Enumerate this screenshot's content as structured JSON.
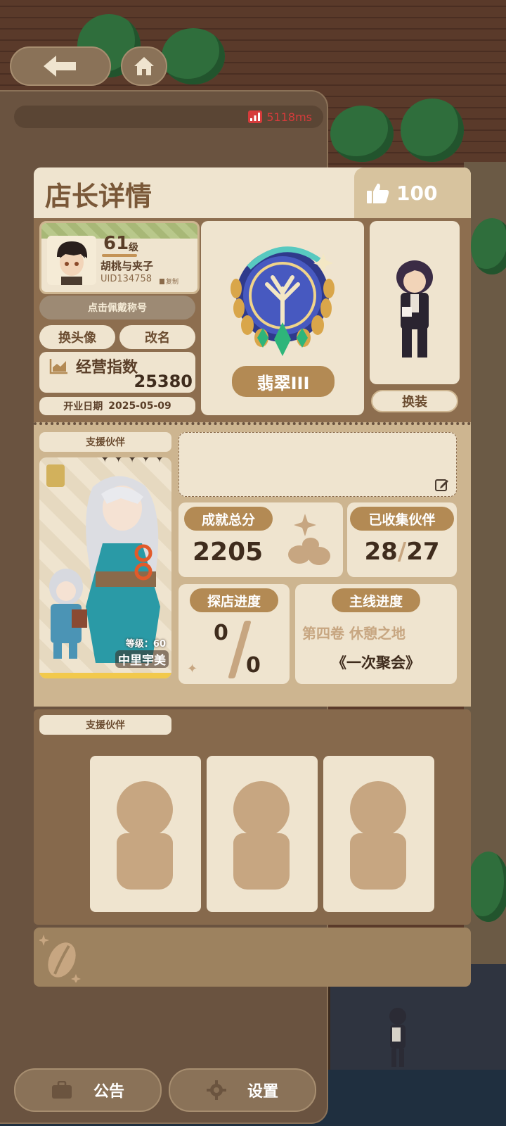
{
  "ping": {
    "value": "5118ms",
    "color": "#d63b3b",
    "icon": "signal-icon"
  },
  "header": {
    "title": "店长详情",
    "likes": "100",
    "like_icon": "thumbs-up-icon"
  },
  "profile": {
    "level": "61",
    "level_unit": "级",
    "name": "胡桃与夹子",
    "uid": "UID134758",
    "copy_label": "复制",
    "wear_title_label": "点击佩戴称号",
    "change_avatar_label": "换头像",
    "rename_label": "改名",
    "business_index_label": "经营指数",
    "business_index_value": "25380",
    "open_date_label": "开业日期",
    "open_date_value": "2025-05-09"
  },
  "rank": {
    "name": "翡翠III"
  },
  "outfit": {
    "change_label": "换装"
  },
  "support": {
    "label": "支援伙伴",
    "partner_level": "等级：60",
    "partner_name": "中里宇美"
  },
  "stats": {
    "achievement_label": "成就总分",
    "achievement_value": "2205",
    "collected_label": "已收集伙伴",
    "collected_value": "28",
    "collected_total": "27",
    "explore_label": "探店进度",
    "explore_value": "0",
    "explore_total": "0",
    "mainline_label": "主线进度",
    "mainline_volume": "第四卷 休憩之地",
    "mainline_chapter": "《一次聚会》"
  },
  "support2": {
    "label": "支援伙伴"
  },
  "bottom": {
    "notice_label": "公告",
    "settings_label": "设置"
  }
}
